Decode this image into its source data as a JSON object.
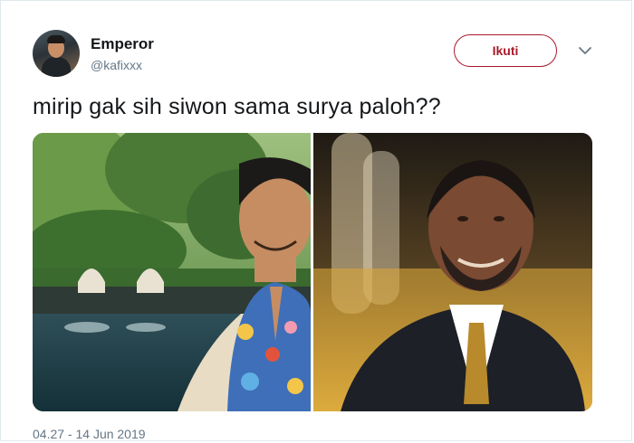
{
  "tweet": {
    "author_name": "Emperor",
    "author_handle": "@kafixxx",
    "follow_label": "Ikuti",
    "more_icon": "chevron-down-icon",
    "text": "mirip gak sih siwon sama surya paloh??",
    "timestamp": "04.27 - 14 Jun 2019"
  },
  "colors": {
    "follow_accent": "#a81a2a",
    "secondary_text": "#657786",
    "primary_text": "#14171a"
  }
}
